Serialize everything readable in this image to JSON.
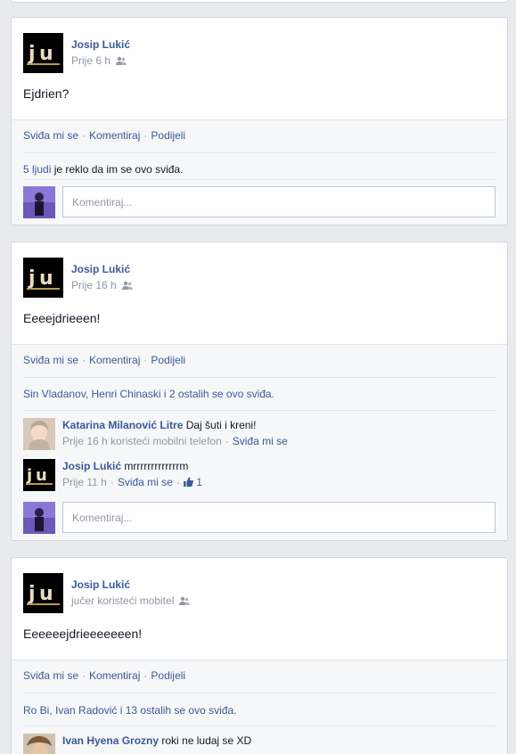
{
  "posts": [
    {
      "author": "Josip Lukić",
      "time": "Prije 6 h",
      "text": "Ejdrien?",
      "actions": {
        "like": "Sviđa mi se",
        "comment": "Komentiraj",
        "share": "Podijeli"
      },
      "likes": {
        "link": "5 ljudi",
        "rest": " je reklo da im se ovo sviđa."
      },
      "comment_placeholder": "Komentiraj..."
    },
    {
      "author": "Josip Lukić",
      "time": "Prije 16 h",
      "text": "Eeeejdrieeen!",
      "actions": {
        "like": "Sviđa mi se",
        "comment": "Komentiraj",
        "share": "Podijeli"
      },
      "likes": {
        "text": "Sin Vladanov, Henri Chinaski i 2 ostalih se ovo sviđa."
      },
      "comments": [
        {
          "name": "Katarina Milanović Litre",
          "text": "Daj šuti i kreni!",
          "time": "Prije 16 h koristeći mobilni telefon",
          "like": "Sviđa mi se"
        },
        {
          "name": "Josip Lukić",
          "text": "mrrrrrrrrrrrrrm",
          "time": "Prije 11 h",
          "like": "Sviđa mi se",
          "like_count": "1"
        }
      ],
      "comment_placeholder": "Komentiraj..."
    },
    {
      "author": "Josip Lukić",
      "time": "jučer koristeći mobitel",
      "text": "Eeeeeejdrieeeeeeen!",
      "actions": {
        "like": "Sviđa mi se",
        "comment": "Komentiraj",
        "share": "Podijeli"
      },
      "likes": {
        "text": "Ro Bi, Ivan Radović i 13 ostalih se ovo sviđa."
      },
      "comments": [
        {
          "name": "Ivan Hyena Grozny",
          "text": "roki ne ludaj se XD"
        }
      ]
    }
  ],
  "colors": {
    "link": "#3b5998",
    "background": "#e9eaed",
    "muted": "#9197a3"
  },
  "icons": {
    "friends": "friends-icon",
    "thumbs_up": "thumbs-up-icon"
  }
}
